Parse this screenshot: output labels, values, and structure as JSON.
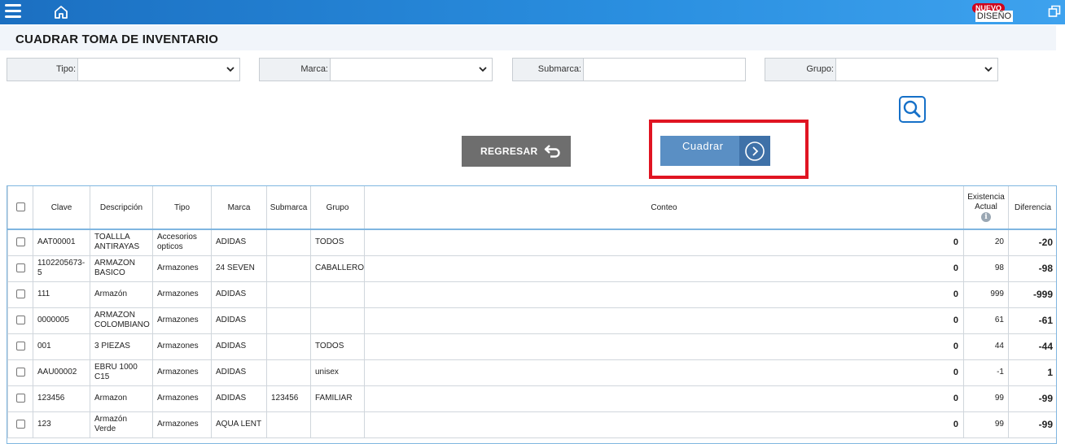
{
  "header": {
    "badge_new": "NUEVO",
    "badge_design": "DISEÑO",
    "icons": [
      "menu-icon",
      "home-icon",
      "window-restore-icon"
    ]
  },
  "page": {
    "title": "CUADRAR TOMA DE INVENTARIO"
  },
  "filters": {
    "tipo": {
      "label": "Tipo:",
      "value": ""
    },
    "marca": {
      "label": "Marca:",
      "value": ""
    },
    "submarca": {
      "label": "Submarca:",
      "value": ""
    },
    "grupo": {
      "label": "Grupo:",
      "value": ""
    }
  },
  "actions": {
    "regresar": "REGRESAR",
    "cuadrar": "Cuadrar"
  },
  "colors": {
    "topbar": "#1b6fc1",
    "cuadrar_button": "#5a8fc4",
    "regresar_button": "#6e6e6e",
    "highlight": "#e01422"
  },
  "table": {
    "headers": {
      "clave": "Clave",
      "descripcion": "Descripción",
      "tipo": "Tipo",
      "marca": "Marca",
      "submarca": "Submarca",
      "grupo": "Grupo",
      "conteo": "Conteo",
      "existencia_1": "Existencia",
      "existencia_2": "Actual",
      "diferencia": "Diferencia"
    },
    "rows": [
      {
        "clave": "AAT00001",
        "descripcion": "TOALLLA ANTIRAYAS",
        "tipo": "Accesorios opticos",
        "marca": "ADIDAS",
        "submarca": "",
        "grupo": "TODOS",
        "conteo": "0",
        "existencia": "20",
        "diferencia": "-20"
      },
      {
        "clave": "1102205673-5",
        "descripcion": "ARMAZON BASICO",
        "tipo": "Armazones",
        "marca": "24 SEVEN",
        "submarca": "",
        "grupo": "CABALLERO",
        "conteo": "0",
        "existencia": "98",
        "diferencia": "-98"
      },
      {
        "clave": "111",
        "descripcion": "Armazón",
        "tipo": "Armazones",
        "marca": "ADIDAS",
        "submarca": "",
        "grupo": "",
        "conteo": "0",
        "existencia": "999",
        "diferencia": "-999"
      },
      {
        "clave": "0000005",
        "descripcion": "ARMAZON COLOMBIANO",
        "tipo": "Armazones",
        "marca": "ADIDAS",
        "submarca": "",
        "grupo": "",
        "conteo": "0",
        "existencia": "61",
        "diferencia": "-61"
      },
      {
        "clave": "001",
        "descripcion": "3 PIEZAS",
        "tipo": "Armazones",
        "marca": "ADIDAS",
        "submarca": "",
        "grupo": "TODOS",
        "conteo": "0",
        "existencia": "44",
        "diferencia": "-44"
      },
      {
        "clave": "AAU00002",
        "descripcion": "EBRU 1000 C15",
        "tipo": "Armazones",
        "marca": "ADIDAS",
        "submarca": "",
        "grupo": "unisex",
        "conteo": "0",
        "existencia": "-1",
        "diferencia": "1"
      },
      {
        "clave": "123456",
        "descripcion": "Armazon",
        "tipo": "Armazones",
        "marca": "ADIDAS",
        "submarca": "123456",
        "grupo": "FAMILIAR",
        "conteo": "0",
        "existencia": "99",
        "diferencia": "-99"
      },
      {
        "clave": "123",
        "descripcion": "Armazón Verde",
        "tipo": "Armazones",
        "marca": "AQUA LENT",
        "submarca": "",
        "grupo": "",
        "conteo": "0",
        "existencia": "99",
        "diferencia": "-99"
      }
    ]
  }
}
